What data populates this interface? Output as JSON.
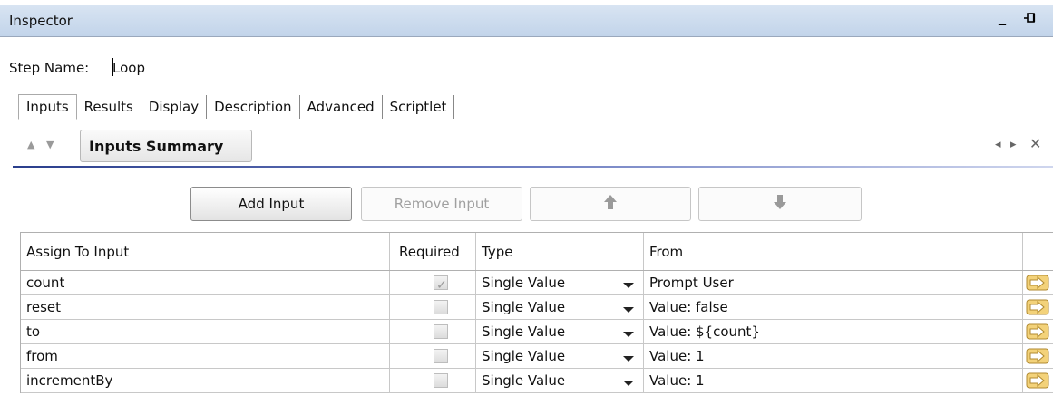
{
  "window": {
    "title": "Inspector",
    "minimize": "_"
  },
  "step_name": {
    "label": "Step Name:",
    "value": "Loop"
  },
  "tabs": [
    {
      "label": "Inputs",
      "active": true
    },
    {
      "label": "Results"
    },
    {
      "label": "Display"
    },
    {
      "label": "Description"
    },
    {
      "label": "Advanced"
    },
    {
      "label": "Scriptlet"
    }
  ],
  "subbar": {
    "summary_label": "Inputs Summary"
  },
  "toolbar": {
    "add_label": "Add Input",
    "remove_label": "Remove Input"
  },
  "table": {
    "headers": [
      "Assign To Input",
      "Required",
      "Type",
      "From"
    ],
    "rows": [
      {
        "name": "count",
        "required": true,
        "type": "Single Value",
        "from": "Prompt User"
      },
      {
        "name": "reset",
        "required": false,
        "type": "Single Value",
        "from": "Value: false"
      },
      {
        "name": "to",
        "required": false,
        "type": "Single Value",
        "from": "Value: ${count}"
      },
      {
        "name": "from",
        "required": false,
        "type": "Single Value",
        "from": "Value: 1"
      },
      {
        "name": "incrementBy",
        "required": false,
        "type": "Single Value",
        "from": "Value: 1"
      }
    ]
  },
  "icons": {
    "pin": "pin-icon",
    "up": "arrow-up-icon",
    "down": "arrow-down-icon",
    "assign": "assign-arrow-icon",
    "close": "close-icon"
  },
  "colors": {
    "titlebar": "#c8d8ec",
    "accent_line": "#2a3e8c"
  }
}
